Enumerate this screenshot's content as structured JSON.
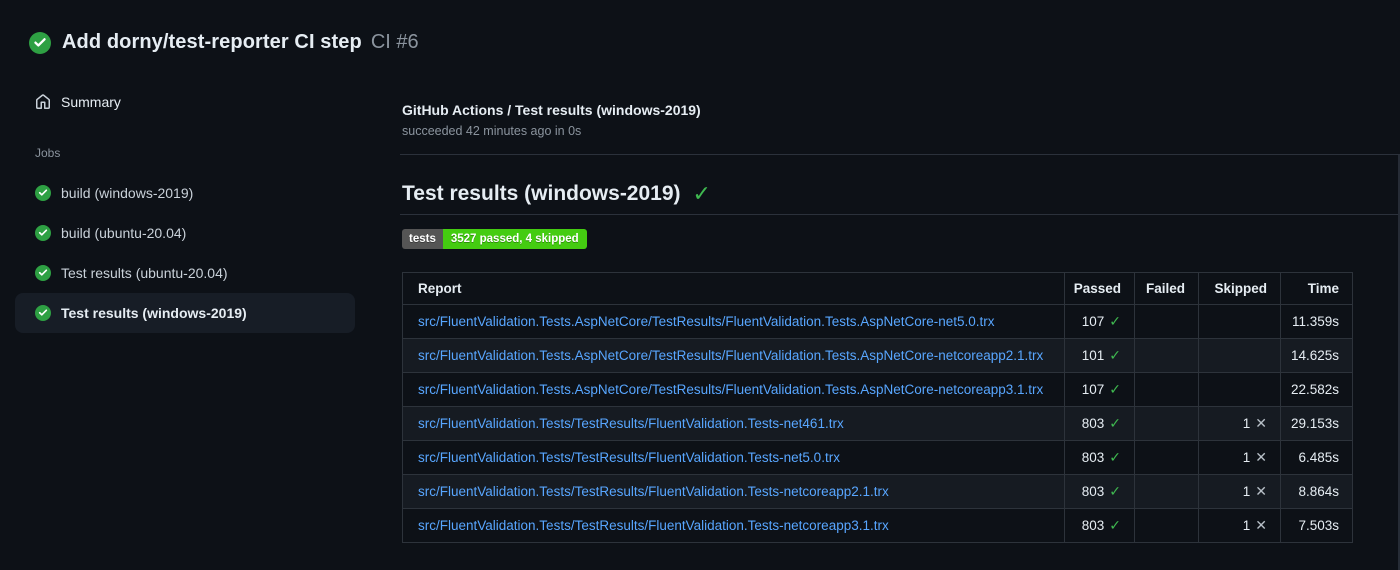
{
  "icons": {
    "check": "✓",
    "cross": "✕"
  },
  "header": {
    "title": "Add dorny/test-reporter CI step",
    "run_number": "CI #6"
  },
  "sidebar": {
    "summary_label": "Summary",
    "jobs_label": "Jobs",
    "jobs": [
      {
        "label": "build (windows-2019)",
        "status": "success",
        "selected": false
      },
      {
        "label": "build (ubuntu-20.04)",
        "status": "success",
        "selected": false
      },
      {
        "label": "Test results (ubuntu-20.04)",
        "status": "success",
        "selected": false
      },
      {
        "label": "Test results (windows-2019)",
        "status": "success",
        "selected": true
      }
    ]
  },
  "main": {
    "check_title": "GitHub Actions / Test results (windows-2019)",
    "check_status": "succeeded 42 minutes ago in 0s",
    "section_title": "Test results (windows-2019)",
    "badge": {
      "label": "tests",
      "value": "3527 passed, 4 skipped",
      "label_bg": "#555555",
      "value_bg": "#44cc11"
    },
    "table": {
      "columns": [
        "Report",
        "Passed",
        "Failed",
        "Skipped",
        "Time"
      ],
      "rows": [
        {
          "report": "src/FluentValidation.Tests.AspNetCore/TestResults/FluentValidation.Tests.AspNetCore-net5.0.trx",
          "passed": "107",
          "failed": "",
          "skipped": "",
          "time": "11.359s"
        },
        {
          "report": "src/FluentValidation.Tests.AspNetCore/TestResults/FluentValidation.Tests.AspNetCore-netcoreapp2.1.trx",
          "passed": "101",
          "failed": "",
          "skipped": "",
          "time": "14.625s"
        },
        {
          "report": "src/FluentValidation.Tests.AspNetCore/TestResults/FluentValidation.Tests.AspNetCore-netcoreapp3.1.trx",
          "passed": "107",
          "failed": "",
          "skipped": "",
          "time": "22.582s"
        },
        {
          "report": "src/FluentValidation.Tests/TestResults/FluentValidation.Tests-net461.trx",
          "passed": "803",
          "failed": "",
          "skipped": "1",
          "time": "29.153s"
        },
        {
          "report": "src/FluentValidation.Tests/TestResults/FluentValidation.Tests-net5.0.trx",
          "passed": "803",
          "failed": "",
          "skipped": "1",
          "time": "6.485s"
        },
        {
          "report": "src/FluentValidation.Tests/TestResults/FluentValidation.Tests-netcoreapp2.1.trx",
          "passed": "803",
          "failed": "",
          "skipped": "1",
          "time": "8.864s"
        },
        {
          "report": "src/FluentValidation.Tests/TestResults/FluentValidation.Tests-netcoreapp3.1.trx",
          "passed": "803",
          "failed": "",
          "skipped": "1",
          "time": "7.503s"
        }
      ]
    }
  },
  "colors": {
    "background": "#0d1117",
    "success_green": "#2ea043",
    "check_green": "#3fb950",
    "link_blue": "#58a6ff",
    "text_secondary": "#8b949e"
  }
}
